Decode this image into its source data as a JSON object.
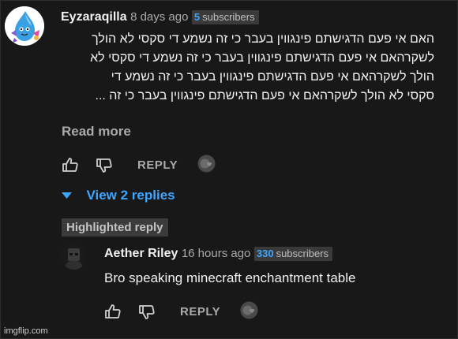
{
  "comment": {
    "author": "Eyzaraqilla",
    "time": "8 days ago",
    "subscribers_count": "5",
    "subscribers_label": "subscribers",
    "body_lines": [
      "האם אי פעם הדגישתם פינגווין בעבר כי זה נשמע די סקסי לא הולך",
      "לשקרהאם אי פעם הדגישתם פינגווין בעבר כי זה נשמע די סקסי לא",
      "הולך לשקרהאם אי פעם הדגישתם פינגווין בעבר כי זה נשמע די",
      "סקסי לא הולך לשקרהאם אי פעם הדגישתם פינגווין בעבר כי זה ..."
    ],
    "read_more": "Read more",
    "reply_label": "REPLY",
    "view_replies": "View 2 replies"
  },
  "reply": {
    "badge": "Highlighted reply",
    "author": "Aether Riley",
    "time": "16 hours ago",
    "subscribers_count": "330",
    "subscribers_label": "subscribers",
    "text": "Bro speaking minecraft enchantment table",
    "reply_label": "REPLY"
  },
  "watermark": "imgflip.com",
  "icons": {
    "like": "thumbs-up-icon",
    "dislike": "thumbs-down-icon",
    "creator_heart": "creator-heart-avatar-icon",
    "expand": "caret-down-icon"
  },
  "colors": {
    "background": "#181818",
    "link_blue": "#3ea6ff",
    "muted": "#aaaaaa"
  }
}
